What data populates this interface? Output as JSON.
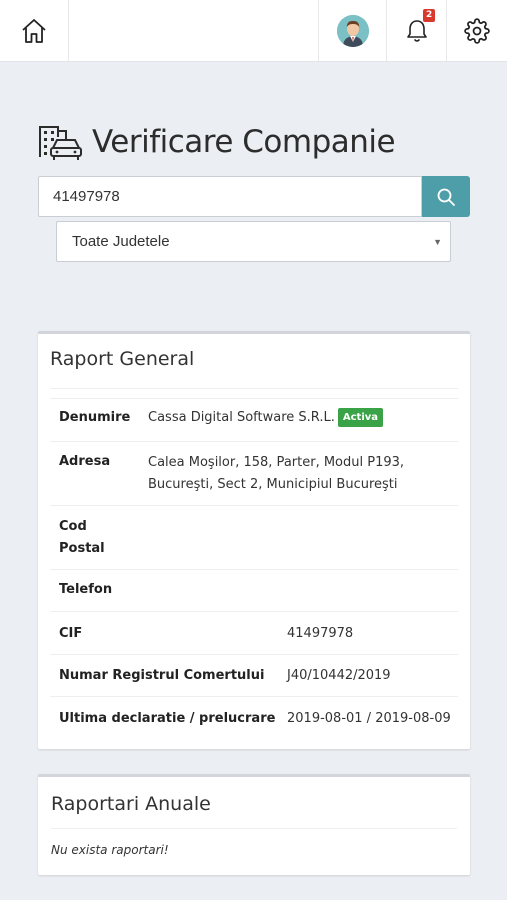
{
  "header": {
    "notification_count": "2",
    "icons": [
      "home-icon",
      "avatar",
      "bell-icon",
      "gear-icon"
    ]
  },
  "page": {
    "title": "Verificare Companie"
  },
  "search": {
    "value": "41497978"
  },
  "county_select": {
    "selected": "Toate Judetele"
  },
  "raport_general": {
    "title": "Raport General",
    "rows": [
      {
        "label": "Denumire",
        "value": "Cassa Digital Software S.R.L.",
        "status": "Activa"
      },
      {
        "label": "Adresa",
        "value_line1": "Calea Moşilor, 158, Parter, Modul P193,",
        "value_line2": "Bucureşti, Sect 2, Municipiul Bucureşti"
      },
      {
        "label_line1": "Cod",
        "label_line2": "Postal",
        "value": ""
      },
      {
        "label": "Telefon",
        "value": ""
      },
      {
        "label": "CIF",
        "value": "41497978"
      },
      {
        "label": "Numar Registrul Comertului",
        "value": "J40/10442/2019"
      },
      {
        "label": "Ultima declaratie / prelucrare",
        "value": "2019-08-01 / 2019-08-09"
      }
    ]
  },
  "raportari_anuale": {
    "title": "Raportari Anuale",
    "empty_message": "Nu exista raportari!"
  },
  "colors": {
    "accent": "#4e9ea9",
    "status_active": "#3aa348",
    "badge": "#d9382d",
    "background": "#ebeef2"
  }
}
